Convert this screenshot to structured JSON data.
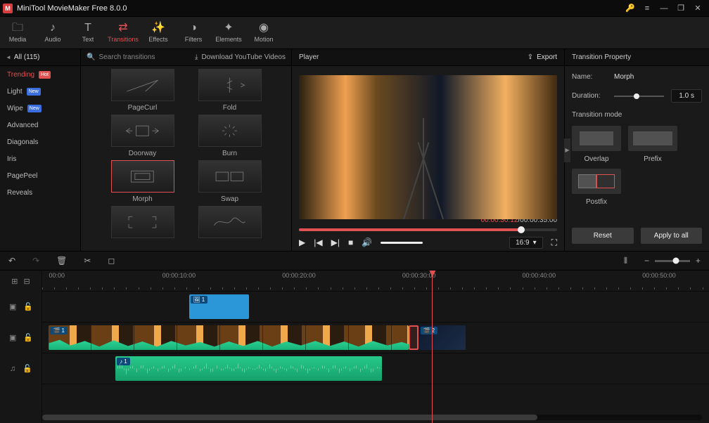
{
  "app": {
    "title": "MiniTool MovieMaker Free 8.0.0"
  },
  "toolbar": {
    "tabs": [
      {
        "label": "Media",
        "icon": "🗀"
      },
      {
        "label": "Audio",
        "icon": "♪"
      },
      {
        "label": "Text",
        "icon": "T"
      },
      {
        "label": "Transitions",
        "icon": "⇄",
        "active": true
      },
      {
        "label": "Effects",
        "icon": "✨"
      },
      {
        "label": "Filters",
        "icon": "◑"
      },
      {
        "label": "Elements",
        "icon": "✦"
      },
      {
        "label": "Motion",
        "icon": "◉"
      }
    ]
  },
  "sidebar": {
    "header": "All (115)",
    "items": [
      {
        "label": "Trending",
        "badge": "Hot",
        "badgeClass": "hot",
        "active": true
      },
      {
        "label": "Light",
        "badge": "New",
        "badgeClass": "new"
      },
      {
        "label": "Wipe",
        "badge": "New",
        "badgeClass": "new"
      },
      {
        "label": "Advanced"
      },
      {
        "label": "Diagonals"
      },
      {
        "label": "Iris"
      },
      {
        "label": "PagePeel"
      },
      {
        "label": "Reveals"
      }
    ]
  },
  "browser": {
    "search_placeholder": "Search transitions",
    "download_label": "Download YouTube Videos",
    "cells": [
      {
        "label": "PageCurl"
      },
      {
        "label": "Fold"
      },
      {
        "label": "Doorway"
      },
      {
        "label": "Burn"
      },
      {
        "label": "Morph",
        "selected": true
      },
      {
        "label": "Swap"
      }
    ]
  },
  "player": {
    "title": "Player",
    "export": "Export",
    "time_current": "00:00:30:12",
    "time_sep": " / ",
    "time_total": "00:00:35:00",
    "aspect": "16:9",
    "progress_pct": 86
  },
  "props": {
    "title": "Transition Property",
    "name_label": "Name:",
    "name_value": "Morph",
    "duration_label": "Duration:",
    "duration_value": "1.0 s",
    "mode_label": "Transition mode",
    "modes": [
      "Overlap",
      "Prefix",
      "Postfix"
    ],
    "selected_mode": "Postfix",
    "reset": "Reset",
    "apply": "Apply to all"
  },
  "timeline": {
    "ruler": [
      "00:00",
      "00:00:10:00",
      "00:00:20:00",
      "00:00:30:00",
      "00:00:40:00",
      "00:00:50:00"
    ],
    "playhead_pct": 56,
    "tracks": {
      "image": {
        "clip": {
          "tag": "1",
          "left_pct": 22,
          "width_pct": 9
        }
      },
      "video": {
        "clip1": {
          "tag": "1",
          "left_pct": 1,
          "width_pct": 54
        },
        "clip2": {
          "tag": "2",
          "left_pct": 56,
          "width_pct": 7
        },
        "transition_left_pct": 55
      },
      "audio": {
        "clip": {
          "tag": "1",
          "left_pct": 11,
          "width_pct": 40
        }
      }
    }
  }
}
